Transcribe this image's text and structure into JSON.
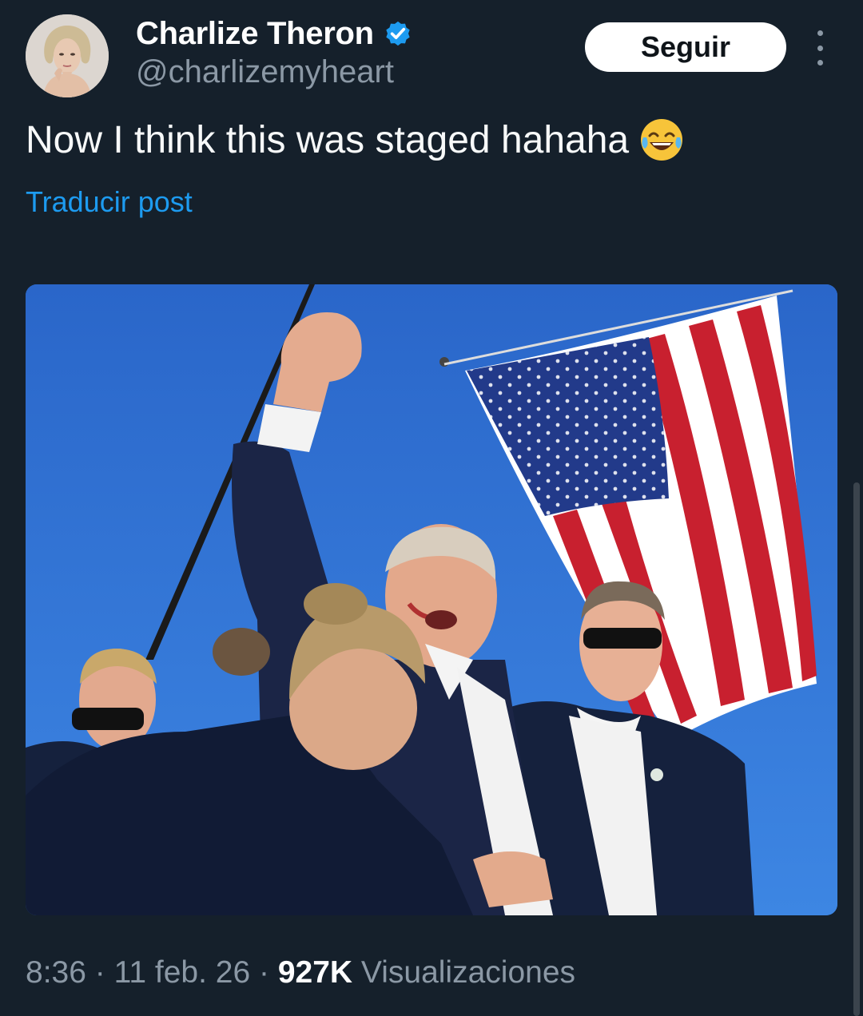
{
  "author": {
    "display_name": "Charlize Theron",
    "handle": "@charlizemyheart",
    "verified": true,
    "avatar_icon": "profile-photo"
  },
  "actions": {
    "follow_label": "Seguir",
    "more_icon": "more-vertical-icon"
  },
  "post": {
    "text": "Now I think this was staged hahaha",
    "emoji": "😂",
    "translate_label": "Traducir post",
    "media_description_icon": "photo"
  },
  "meta": {
    "time": "8:36",
    "separator1": " · ",
    "date": "11 feb. 26",
    "separator2": " · ",
    "views_count": "927K",
    "views_label": " Visualizaciones"
  },
  "colors": {
    "background": "#15202b",
    "link": "#1d9bf0",
    "verified": "#1d9bf0",
    "secondary_text": "#8b98a5"
  }
}
